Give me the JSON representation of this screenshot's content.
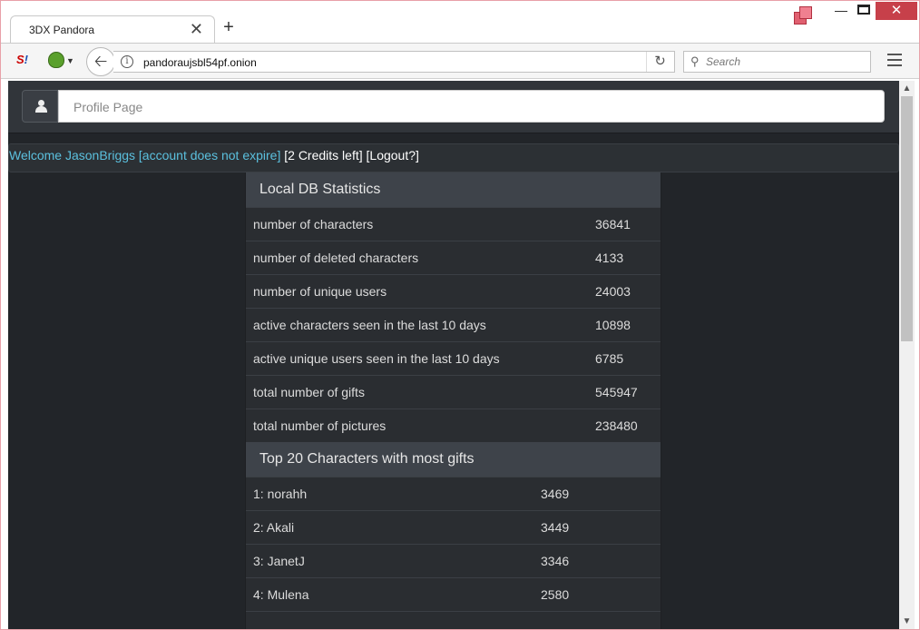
{
  "browser": {
    "tab_title": "3DX Pandora",
    "tab_close": "✕",
    "new_tab": "+",
    "url": "pandoraujsbl54pf.onion",
    "search_placeholder": "Search",
    "icons": [
      "noscript-icon",
      "onion-icon",
      "back-icon",
      "info-icon",
      "reload-icon",
      "search-icon",
      "menu-icon",
      "restore-icon"
    ]
  },
  "header": {
    "profile_label": "Profile Page"
  },
  "welcome": {
    "user_link": "Welcome JasonBriggs [account does not expire]",
    "credits": "[2 Credits left]",
    "logout": "[Logout?]",
    "link_color": "#5bc0de"
  },
  "db_stats": {
    "title": "Local DB Statistics",
    "rows": [
      {
        "label": "number of characters",
        "value": "36841"
      },
      {
        "label": "number of deleted characters",
        "value": "4133"
      },
      {
        "label": "number of unique users",
        "value": "24003"
      },
      {
        "label": "active characters seen in the last 10 days",
        "value": "10898"
      },
      {
        "label": "active unique users seen in the last 10 days",
        "value": "6785"
      },
      {
        "label": "total number of gifts",
        "value": "545947"
      },
      {
        "label": "total number of pictures",
        "value": "238480"
      }
    ]
  },
  "top_gifts": {
    "title": "Top 20 Characters with most gifts",
    "rows": [
      {
        "label": "1: norahh",
        "value": "3469"
      },
      {
        "label": "2: Akali",
        "value": "3449"
      },
      {
        "label": "3: JanetJ",
        "value": "3346"
      },
      {
        "label": "4: Mulena",
        "value": "2580"
      }
    ]
  }
}
